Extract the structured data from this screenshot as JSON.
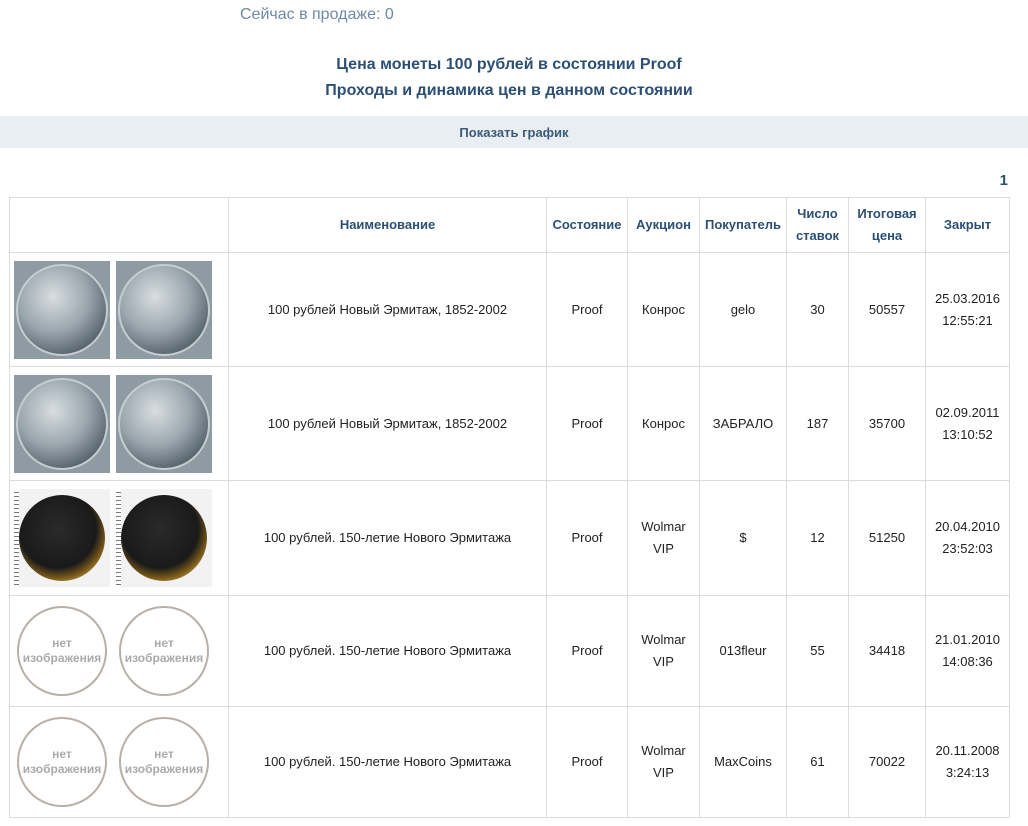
{
  "header": {
    "on_sale": "Сейчас в продаже: 0",
    "title_line1": "Цена монеты 100 рублей в состоянии Proof",
    "title_line2": "Проходы и динамика цен в данном состоянии",
    "show_chart": "Показать график"
  },
  "pagination": {
    "current": "1"
  },
  "table": {
    "headers": {
      "name": "Наименование",
      "condition": "Состояние",
      "auction": "Аукцион",
      "buyer": "Покупатель",
      "bids": "Число ставок",
      "price": "Итоговая цена",
      "closed": "Закрыт"
    },
    "no_image": "нет изображения",
    "rows": [
      {
        "image_type": "silver",
        "name": "100 рублей Новый Эрмитаж, 1852-2002",
        "condition": "Proof",
        "auction": "Конрос",
        "buyer": "gelo",
        "bids": "30",
        "price": "50557",
        "date": "25.03.2016",
        "time": "12:55:21"
      },
      {
        "image_type": "silver",
        "name": "100 рублей Новый Эрмитаж, 1852-2002",
        "condition": "Proof",
        "auction": "Конрос",
        "buyer": "ЗАБРАЛО",
        "bids": "187",
        "price": "35700",
        "date": "02.09.2011",
        "time": "13:10:52"
      },
      {
        "image_type": "gold",
        "name": "100 рублей. 150-летие Нового Эрмитажа",
        "condition": "Proof",
        "auction": "Wolmar VIP",
        "buyer": "$",
        "bids": "12",
        "price": "51250",
        "date": "20.04.2010",
        "time": "23:52:03"
      },
      {
        "image_type": "none",
        "name": "100 рублей. 150-летие Нового Эрмитажа",
        "condition": "Proof",
        "auction": "Wolmar VIP",
        "buyer": "013fleur",
        "bids": "55",
        "price": "34418",
        "date": "21.01.2010",
        "time": "14:08:36"
      },
      {
        "image_type": "none",
        "name": "100 рублей. 150-летие Нового Эрмитажа",
        "condition": "Proof",
        "auction": "Wolmar VIP",
        "buyer": "MaxCoins",
        "bids": "61",
        "price": "70022",
        "date": "20.11.2008",
        "time": "3:24:13"
      }
    ]
  }
}
